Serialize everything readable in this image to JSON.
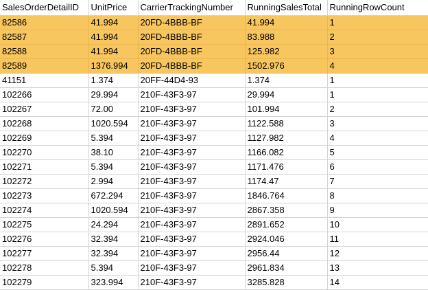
{
  "grid": {
    "columns": [
      "SalesOrderDetailID",
      "UnitPrice",
      "CarrierTrackingNumber",
      "RunningSalesTotal",
      "RunningRowCount"
    ],
    "highlight_color": "#f7c65e",
    "rows": [
      {
        "cells": [
          "82586",
          "41.994",
          "20FD-4BBB-BF",
          "41.994",
          "1"
        ],
        "highlighted": true
      },
      {
        "cells": [
          "82587",
          "41.994",
          "20FD-4BBB-BF",
          "83.988",
          "2"
        ],
        "highlighted": true
      },
      {
        "cells": [
          "82588",
          "41.994",
          "20FD-4BBB-BF",
          "125.982",
          "3"
        ],
        "highlighted": true
      },
      {
        "cells": [
          "82589",
          "1376.994",
          "20FD-4BBB-BF",
          "1502.976",
          "4"
        ],
        "highlighted": true
      },
      {
        "cells": [
          "41151",
          "1.374",
          "20FF-44D4-93",
          "1.374",
          "1"
        ],
        "highlighted": false
      },
      {
        "cells": [
          "102266",
          "29.994",
          "210F-43F3-97",
          "29.994",
          "1"
        ],
        "highlighted": false
      },
      {
        "cells": [
          "102267",
          "72.00",
          "210F-43F3-97",
          "101.994",
          "2"
        ],
        "highlighted": false
      },
      {
        "cells": [
          "102268",
          "1020.594",
          "210F-43F3-97",
          "1122.588",
          "3"
        ],
        "highlighted": false
      },
      {
        "cells": [
          "102269",
          "5.394",
          "210F-43F3-97",
          "1127.982",
          "4"
        ],
        "highlighted": false
      },
      {
        "cells": [
          "102270",
          "38.10",
          "210F-43F3-97",
          "1166.082",
          "5"
        ],
        "highlighted": false
      },
      {
        "cells": [
          "102271",
          "5.394",
          "210F-43F3-97",
          "1171.476",
          "6"
        ],
        "highlighted": false
      },
      {
        "cells": [
          "102272",
          "2.994",
          "210F-43F3-97",
          "1174.47",
          "7"
        ],
        "highlighted": false
      },
      {
        "cells": [
          "102273",
          "672.294",
          "210F-43F3-97",
          "1846.764",
          "8"
        ],
        "highlighted": false
      },
      {
        "cells": [
          "102274",
          "1020.594",
          "210F-43F3-97",
          "2867.358",
          "9"
        ],
        "highlighted": false
      },
      {
        "cells": [
          "102275",
          "24.294",
          "210F-43F3-97",
          "2891.652",
          "10"
        ],
        "highlighted": false
      },
      {
        "cells": [
          "102276",
          "32.394",
          "210F-43F3-97",
          "2924.046",
          "11"
        ],
        "highlighted": false
      },
      {
        "cells": [
          "102277",
          "32.394",
          "210F-43F3-97",
          "2956.44",
          "12"
        ],
        "highlighted": false
      },
      {
        "cells": [
          "102278",
          "5.394",
          "210F-43F3-97",
          "2961.834",
          "13"
        ],
        "highlighted": false
      },
      {
        "cells": [
          "102279",
          "323.994",
          "210F-43F3-97",
          "3285.828",
          "14"
        ],
        "highlighted": false
      }
    ]
  }
}
